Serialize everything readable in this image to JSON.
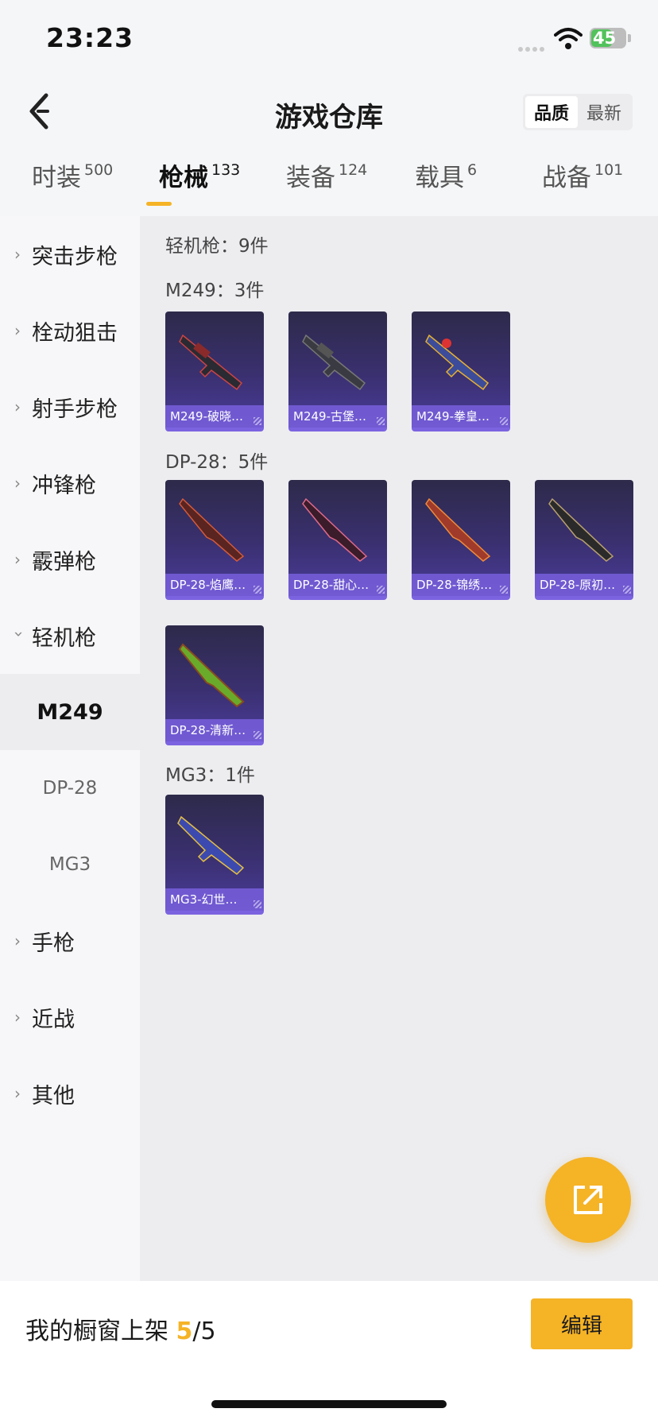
{
  "status_bar": {
    "time": "23:23",
    "battery": "45"
  },
  "header": {
    "title": "游戏仓库",
    "sort_options": [
      {
        "label": "品质",
        "active": true
      },
      {
        "label": "最新",
        "active": false
      }
    ]
  },
  "tabs": [
    {
      "label": "时装",
      "count": "500",
      "active": false
    },
    {
      "label": "枪械",
      "count": "133",
      "active": true
    },
    {
      "label": "装备",
      "count": "124",
      "active": false
    },
    {
      "label": "载具",
      "count": "6",
      "active": false
    },
    {
      "label": "战备",
      "count": "101",
      "active": false
    }
  ],
  "sidebar": {
    "categories": [
      {
        "label": "突击步枪",
        "expanded": false
      },
      {
        "label": "栓动狙击",
        "expanded": false
      },
      {
        "label": "射手步枪",
        "expanded": false
      },
      {
        "label": "冲锋枪",
        "expanded": false
      },
      {
        "label": "霰弹枪",
        "expanded": false
      },
      {
        "label": "轻机枪",
        "expanded": true
      },
      {
        "label": "手枪",
        "expanded": false
      },
      {
        "label": "近战",
        "expanded": false
      },
      {
        "label": "其他",
        "expanded": false
      }
    ],
    "subitems": [
      {
        "label": "M249",
        "selected": true
      },
      {
        "label": "DP-28",
        "selected": false
      },
      {
        "label": "MG3",
        "selected": false
      }
    ]
  },
  "content": {
    "category_header": "轻机枪：9件",
    "groups": [
      {
        "header": "M249：3件",
        "items": [
          "M249-破晓…",
          "M249-古堡…",
          "M249-拳皇…"
        ]
      },
      {
        "header": "DP-28：5件",
        "items": [
          "DP-28-焰鹰…",
          "DP-28-甜心…",
          "DP-28-锦绣…",
          "DP-28-原初…",
          "DP-28-清新…"
        ]
      },
      {
        "header": "MG3：1件",
        "items": [
          "MG3-幻世…"
        ]
      }
    ]
  },
  "bottom_bar": {
    "shelf_label": "我的橱窗上架",
    "shelf_used": "5",
    "shelf_total": "/5",
    "edit_label": "编辑"
  },
  "colors": {
    "accent": "#f5b326",
    "card_purple": "#4a3c9a",
    "card_label": "#785fdc"
  }
}
